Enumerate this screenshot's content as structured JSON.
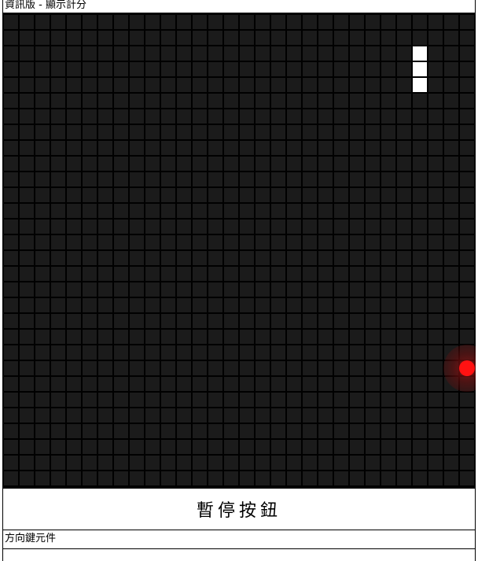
{
  "scoreboard": {
    "text": "資訊版 - 顯示計分"
  },
  "board": {
    "columns": 30,
    "rows": 30,
    "snake": [
      [
        26,
        2
      ],
      [
        26,
        3
      ],
      [
        26,
        4
      ]
    ],
    "food": [
      29,
      22
    ],
    "colors": {
      "cell": "#1b1b1b",
      "snake": "#ffffff",
      "food": "#ff1212",
      "grid_line": "#000000"
    }
  },
  "pause_button": {
    "label": "暫停按鈕"
  },
  "controls": {
    "label": "方向鍵元件"
  }
}
